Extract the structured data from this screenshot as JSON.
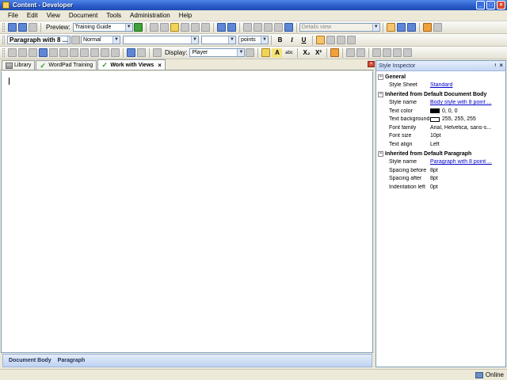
{
  "window": {
    "title": "Content - Developer"
  },
  "menu": [
    "File",
    "Edit",
    "View",
    "Document",
    "Tools",
    "Administration",
    "Help"
  ],
  "toolbar1": {
    "preview_label": "Preview:",
    "preview_value": "Training Guide",
    "view_value": "Details view"
  },
  "toolbar2": {
    "style_value": "Paragraph with 8 ...",
    "mode_value": "Normal",
    "font_value": "",
    "size_value": "",
    "unit_value": "points",
    "bold": "B",
    "italic": "I",
    "underline": "U"
  },
  "toolbar3": {
    "display_label": "Display:",
    "display_value": "Player",
    "highlight_letter": "A",
    "abc_label": "abc",
    "subscript": "X₂",
    "superscript": "X²"
  },
  "tabs": [
    {
      "label": "Library",
      "active": false
    },
    {
      "label": "WordPad Training",
      "active": false
    },
    {
      "label": "Work with Views",
      "active": true
    }
  ],
  "breadcrumb": [
    "Document Body",
    "Paragraph"
  ],
  "inspector": {
    "title": "Style Inspector",
    "sections": [
      {
        "title": "General",
        "props": [
          {
            "name": "Style Sheet",
            "value": "Standard",
            "link": true
          }
        ]
      },
      {
        "title": "Inherited from Default Document Body",
        "props": [
          {
            "name": "Style name",
            "value": "Body style with 8 point ...",
            "link": true
          },
          {
            "name": "Text color",
            "value": "0, 0, 0",
            "swatch": "#000000"
          },
          {
            "name": "Text background color",
            "value": "255, 255, 255",
            "swatch": "#ffffff"
          },
          {
            "name": "Font family",
            "value": "Arial, Helvetica, sans-s..."
          },
          {
            "name": "Font size",
            "value": "10pt"
          },
          {
            "name": "Text align",
            "value": "Left"
          }
        ]
      },
      {
        "title": "Inherited from Default Paragraph",
        "props": [
          {
            "name": "Style name",
            "value": "Paragraph with 8 point ...",
            "link": true
          },
          {
            "name": "Spacing before",
            "value": "8pt"
          },
          {
            "name": "Spacing after",
            "value": "8pt"
          },
          {
            "name": "Indentation left",
            "value": "0pt"
          }
        ]
      }
    ]
  },
  "status": {
    "connection": "Online"
  }
}
